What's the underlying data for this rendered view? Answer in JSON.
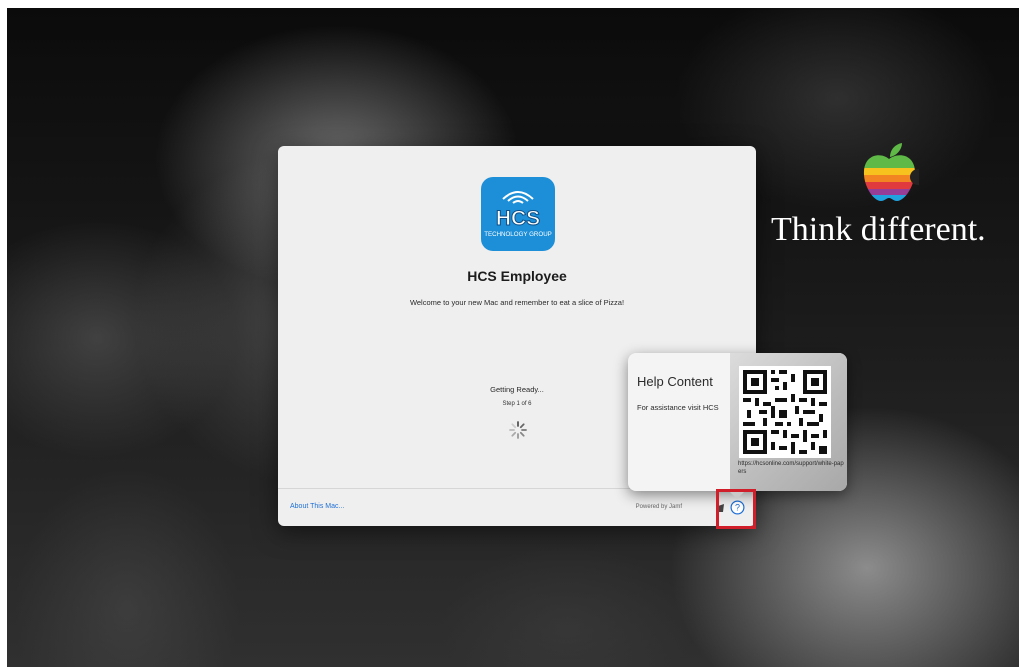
{
  "desktop": {
    "slogan": "Think different.",
    "logo_icon": "apple-rainbow-logo-icon"
  },
  "window": {
    "org_logo": {
      "name": "hcs-technology-group-logo-icon",
      "text": "HCS",
      "subtext": "TECHNOLOGY GROUP",
      "color": "#1d8fd8"
    },
    "title": "HCS Employee",
    "welcome_message": "Welcome to your new Mac and remember to eat a slice of Pizza!",
    "status": "Getting Ready...",
    "step": "Step 1 of 6",
    "spinner_icon": "spinner-icon",
    "footer": {
      "about_link": "About This Mac...",
      "powered_by": "Powered by Jamf",
      "jamf_icon": "jamf-icon",
      "help_icon": "help-question-icon"
    }
  },
  "help_popover": {
    "title": "Help Content",
    "text": "For assistance visit HCS",
    "qr_icon": "qr-code-icon",
    "url": "https://hcsonline.com/support/white-papers"
  },
  "colors": {
    "link": "#1f6fd6",
    "highlight": "#d01f2b",
    "window_bg": "#efefef"
  }
}
